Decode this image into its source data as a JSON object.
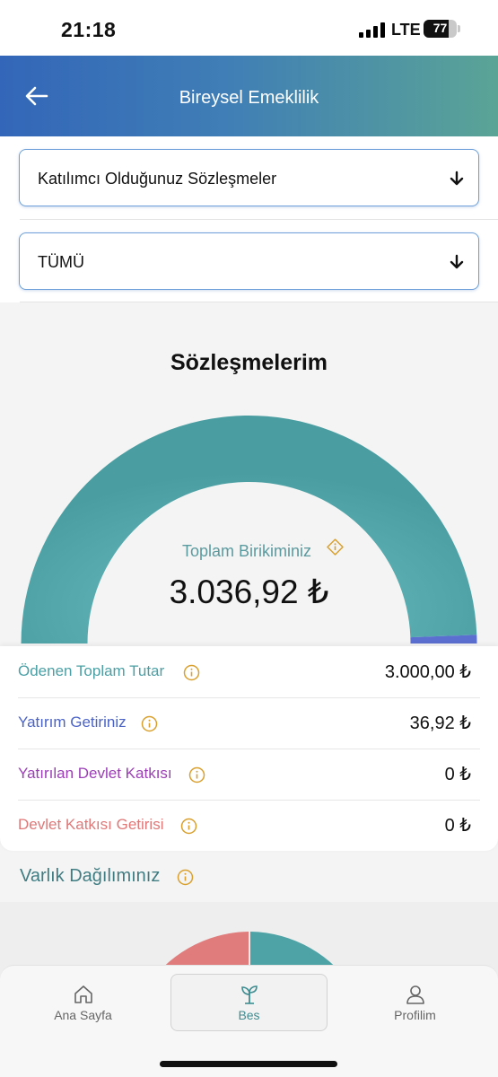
{
  "status_bar": {
    "time": "21:18",
    "network": "LTE",
    "battery": "77",
    "battery_level": 0.77
  },
  "header": {
    "title": "Bireysel Emeklilik",
    "back_icon": "arrow-left-icon"
  },
  "filters": {
    "contract_type": "Katılımcı Olduğunuz Sözleşmeler",
    "scope": "TÜMÜ"
  },
  "summary": {
    "title": "Sözleşmelerim",
    "total_label": "Toplam Birikiminiz",
    "total_value": "3.036,92 ₺"
  },
  "gauge": {
    "segments": [
      {
        "value": 3000.0,
        "color": "#4da3a6"
      },
      {
        "value": 36.92,
        "color": "#5b6fd0"
      },
      {
        "value": 0,
        "color": "#9b3fc0"
      },
      {
        "value": 0,
        "color": "#e07c7c"
      }
    ]
  },
  "breakdown": [
    {
      "label": "Ödenen Toplam Tutar",
      "value": "3.000,00 ₺",
      "color": "#4aa0a5"
    },
    {
      "label": "Yatırım Getiriniz",
      "value": "36,92 ₺",
      "color": "#4b63c6"
    },
    {
      "label": "Yatırılan Devlet Katkısı",
      "value": "0 ₺",
      "color": "#9b3fb5"
    },
    {
      "label": "Devlet Katkısı Getirisi",
      "value": "0 ₺",
      "color": "#e07878"
    }
  ],
  "asset_distribution": {
    "title": "Varlık Dağılımınız"
  },
  "colors": {
    "accent": "#4da3a6",
    "info": "#d9a02e"
  },
  "bottom_nav": [
    {
      "label": "Ana Sayfa",
      "icon": "home-icon"
    },
    {
      "label": "Bes",
      "icon": "sprout-icon",
      "active": true
    },
    {
      "label": "Profilim",
      "icon": "user-icon"
    }
  ]
}
